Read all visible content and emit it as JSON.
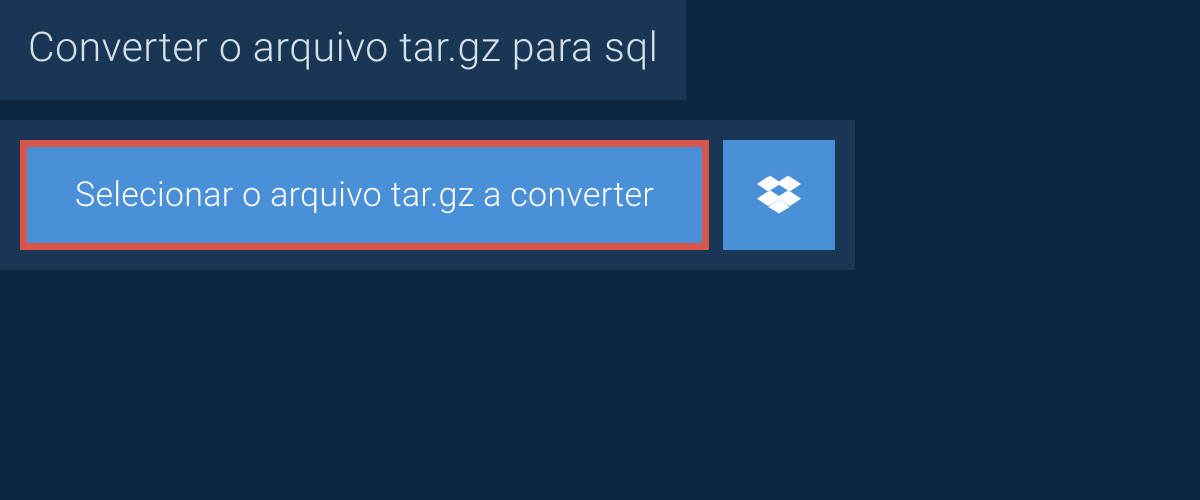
{
  "header": {
    "title": "Converter o arquivo tar.gz para sql"
  },
  "actions": {
    "select_file_label": "Selecionar o arquivo tar.gz a converter"
  }
}
